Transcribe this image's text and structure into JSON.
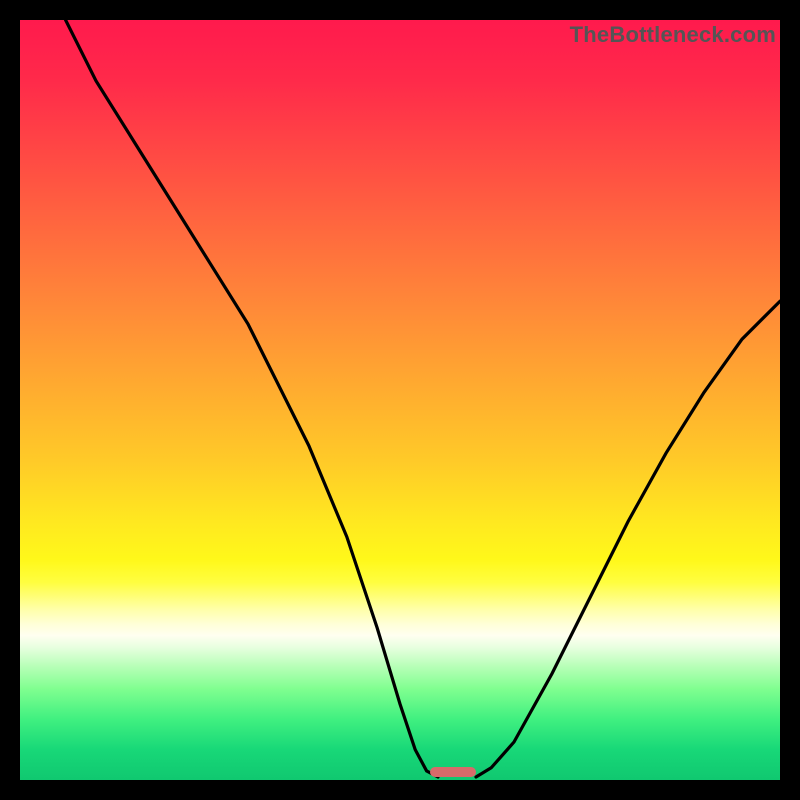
{
  "watermark": "TheBottleneck.com",
  "colors": {
    "frame": "#000000",
    "curve": "#000000",
    "marker": "#d86a6a"
  },
  "chart_data": {
    "type": "line",
    "title": "",
    "xlabel": "",
    "ylabel": "",
    "xlim": [
      0,
      100
    ],
    "ylim": [
      0,
      100
    ],
    "description": "Bottleneck curve: left branch descends from top-left, right branch ascends to the right; minimum near x≈56 at the bottom (green zone). Background is a vertical gradient red→orange→yellow→pale→green. A small pink pill marks the optimum at the bottom.",
    "series": [
      {
        "name": "left-branch",
        "x": [
          6,
          10,
          15,
          20,
          25,
          30,
          33,
          38,
          43,
          47,
          50,
          52,
          53.5,
          55
        ],
        "y": [
          100,
          92,
          84,
          76,
          68,
          60,
          54,
          44,
          32,
          20,
          10,
          4,
          1.2,
          0.4
        ]
      },
      {
        "name": "right-branch",
        "x": [
          60,
          62,
          65,
          70,
          75,
          80,
          85,
          90,
          95,
          100
        ],
        "y": [
          0.4,
          1.6,
          5,
          14,
          24,
          34,
          43,
          51,
          58,
          63
        ]
      }
    ],
    "marker": {
      "x_center": 57,
      "width_pct": 6,
      "y": 0.5
    },
    "gradient_stops": [
      {
        "pct": 0,
        "color": "#ff1a4d"
      },
      {
        "pct": 18,
        "color": "#ff4a44"
      },
      {
        "pct": 38,
        "color": "#ff8a38"
      },
      {
        "pct": 58,
        "color": "#ffca28"
      },
      {
        "pct": 74,
        "color": "#fffe40"
      },
      {
        "pct": 81,
        "color": "#fffff0"
      },
      {
        "pct": 88,
        "color": "#80ff90"
      },
      {
        "pct": 100,
        "color": "#10c870"
      }
    ]
  }
}
